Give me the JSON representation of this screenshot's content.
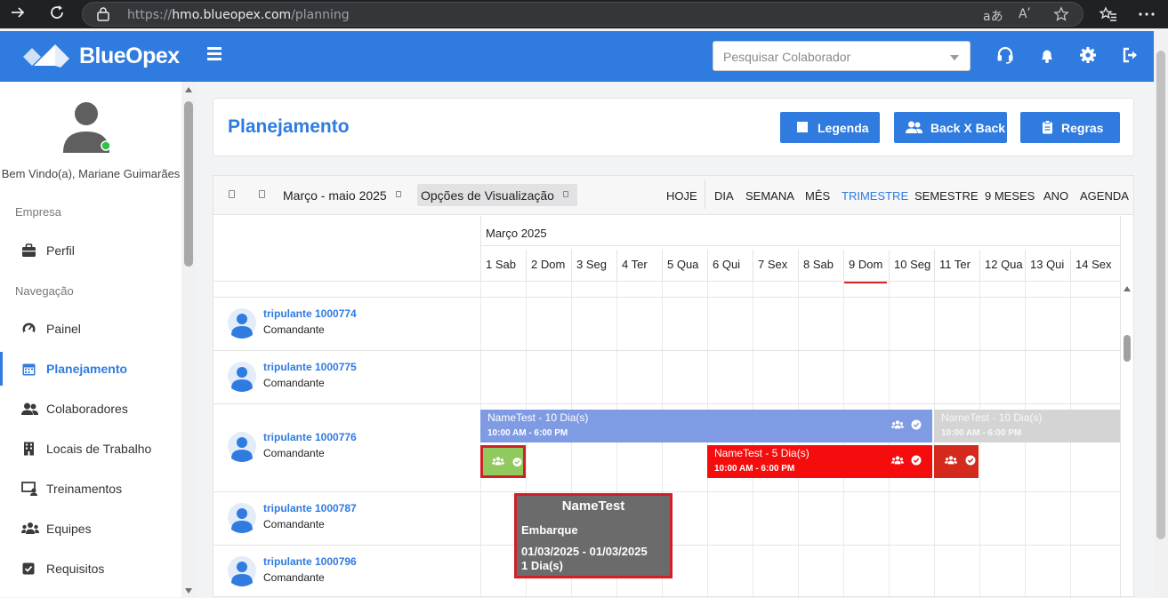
{
  "browser": {
    "url_host": "https://hmo.blueopex.com",
    "url_path": "/planning",
    "url_host_prefix": "https://",
    "url_host_name": "hmo.blueopex.com",
    "reader_glyph": "aあ",
    "aloud_glyph": "Aʹ"
  },
  "header": {
    "brand": "BlueOpex",
    "search_placeholder": "Pesquisar Colaborador"
  },
  "sidebar": {
    "welcome": "Bem Vindo(a), Mariane Guimarães",
    "section_company": "Empresa",
    "section_nav": "Navegação",
    "items": [
      {
        "label": "Perfil",
        "icon": "briefcase-icon"
      },
      {
        "label": "Painel",
        "icon": "gauge-icon"
      },
      {
        "label": "Planejamento",
        "icon": "calendar-icon",
        "active": true
      },
      {
        "label": "Colaboradores",
        "icon": "users-icon"
      },
      {
        "label": "Locais de Trabalho",
        "icon": "building-icon"
      },
      {
        "label": "Treinamentos",
        "icon": "chalkboard-icon"
      },
      {
        "label": "Equipes",
        "icon": "team-icon"
      },
      {
        "label": "Requisitos",
        "icon": "checkbox-icon"
      }
    ]
  },
  "page": {
    "title": "Planejamento",
    "buttons": {
      "legend": "Legenda",
      "back": "Back X Back",
      "rules": "Regras"
    }
  },
  "scheduler": {
    "period": "Março - maio 2025",
    "view_options": "Opções de Visualização",
    "today": "HOJE",
    "views": [
      "DIA",
      "SEMANA",
      "MÊS",
      "TRIMESTRE",
      "SEMESTRE",
      "9 MESES",
      "ANO",
      "AGENDA"
    ],
    "active_view": "TRIMESTRE",
    "month": "Março 2025",
    "days": [
      "1 Sab",
      "2 Dom",
      "3 Seg",
      "4 Ter",
      "5 Qua",
      "6 Qui",
      "7 Sex",
      "8 Sab",
      "9 Dom",
      "10 Seg",
      "11 Ter",
      "12 Qua",
      "13 Qui",
      "14 Sex"
    ],
    "crew": [
      {
        "name": "tripulante 1000774",
        "role": "Comandante"
      },
      {
        "name": "tripulante 1000775",
        "role": "Comandante"
      },
      {
        "name": "tripulante 1000776",
        "role": "Comandante"
      },
      {
        "name": "tripulante 1000787",
        "role": "Comandante"
      },
      {
        "name": "tripulante 1000796",
        "role": "Comandante"
      }
    ],
    "events": {
      "e1_title": "NameTest - 10 Dia(s)",
      "e1_time": "10:00 AM - 6:00 PM",
      "e2_title": "NameTest - 10 Dia(s)",
      "e2_time": "10:00 AM - 6:00 PM",
      "e3_title": "NameTest - 5 Dia(s)",
      "e3_time": "10:00 AM - 6:00 PM"
    },
    "colors": {
      "blue_event": "#7f9be3",
      "grey_event": "#d4d4d4",
      "red_event": "#f50d0d",
      "dark_red_event": "#d42a1e",
      "green_event": "#90c95e",
      "accent": "#2f7be0"
    }
  },
  "tooltip": {
    "title": "NameTest",
    "kind": "Embarque",
    "dates": "01/03/2025 - 01/03/2025",
    "length": "1 Dia(s)"
  }
}
